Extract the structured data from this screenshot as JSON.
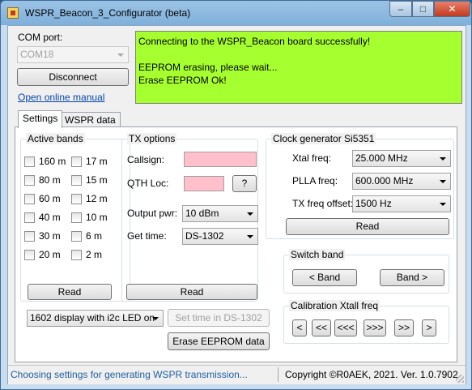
{
  "window": {
    "title": "WSPR_Beacon_3_Configurator (beta)"
  },
  "com": {
    "label": "COM port:",
    "port": "COM18",
    "disconnect": "Disconnect",
    "manual_link": "Open online manual"
  },
  "log": [
    "Connecting to the WSPR_Beacon board successfully!",
    "",
    "EEPROM erasing, please wait...",
    "Erase EEPROM Ok!"
  ],
  "tabs": [
    "Settings",
    "WSPR data"
  ],
  "active_bands": {
    "title": "Active bands",
    "col1": [
      "160 m",
      "80 m",
      "60 m",
      "40 m",
      "30 m",
      "20 m"
    ],
    "col2": [
      "17 m",
      "15 m",
      "12 m",
      "10 m",
      "6 m",
      "2 m"
    ],
    "read": "Read"
  },
  "tx_options": {
    "title": "TX options",
    "callsign_label": "Callsign:",
    "callsign_value": "",
    "qth_label": "QTH Loc:",
    "qth_value": "",
    "qth_help": "?",
    "output_pwr_label": "Output pwr:",
    "output_pwr": "10 dBm",
    "get_time_label": "Get time:",
    "get_time": "DS-1302",
    "read": "Read"
  },
  "display_select": "1602 display with i2c LED on",
  "set_time_button": "Set time in DS-1302",
  "erase_button": "Erase EEPROM data",
  "clock": {
    "title": "Clock generator Si5351",
    "xtal_label": "Xtal freq:",
    "xtal": "25.000 MHz",
    "plla_label": "PLLA freq:",
    "plla": "600.000 MHz",
    "offset_label": "TX freq offset:",
    "offset": "1500 Hz",
    "read": "Read"
  },
  "switch_band": {
    "title": "Switch band",
    "prev": "< Band",
    "next": "Band >"
  },
  "calibration": {
    "title": "Calibration Xtall freq",
    "buttons": [
      "<",
      "<<",
      "<<<",
      ">>>",
      ">>",
      ">"
    ]
  },
  "status": {
    "message": "Choosing settings for generating WSPR transmission...",
    "copyright": "Copyright ©R0AEK, 2021. Ver. 1.0.7902"
  },
  "colors": {
    "log_bg": "#a6ff2e",
    "input_bg": "#ffc0cb",
    "status_text": "#1f5f9f"
  }
}
